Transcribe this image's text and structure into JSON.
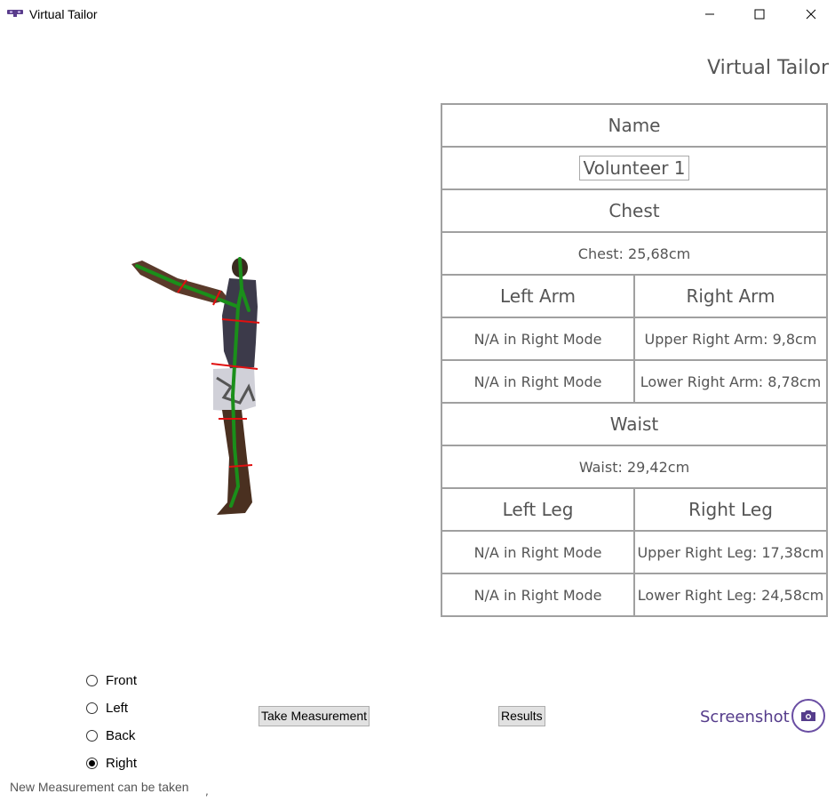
{
  "window": {
    "title": "Virtual Tailor",
    "app_icon": "kinect-icon",
    "controls": [
      "minimize-icon",
      "maximize-icon",
      "close-icon"
    ]
  },
  "header": {
    "title": "Virtual Tailor"
  },
  "table": {
    "name_header": "Name",
    "name_value": "Volunteer 1",
    "chest_header": "Chest",
    "chest_value": "Chest: 25,68cm",
    "left_arm_header": "Left Arm",
    "right_arm_header": "Right Arm",
    "left_arm_upper": "N/A in Right Mode",
    "right_arm_upper": "Upper Right Arm: 9,8cm",
    "left_arm_lower": "N/A in Right Mode",
    "right_arm_lower": "Lower Right Arm: 8,78cm",
    "waist_header": "Waist",
    "waist_value": "Waist: 29,42cm",
    "left_leg_header": "Left Leg",
    "right_leg_header": "Right Leg",
    "left_leg_upper": "N/A in Right Mode",
    "right_leg_upper": "Upper Right Leg: 17,38cm",
    "left_leg_lower": "N/A in Right Mode",
    "right_leg_lower": "Lower Right Leg: 24,58cm"
  },
  "modes": {
    "front": "Front",
    "left": "Left",
    "back": "Back",
    "right": "Right",
    "selected": "Right"
  },
  "buttons": {
    "take_measurement": "Take Measurement",
    "results": "Results"
  },
  "screenshot": {
    "label": "Screenshot",
    "icon": "camera-icon"
  },
  "status": {
    "message": "New Measurement can be taken",
    "trailing": ","
  },
  "colors": {
    "skeleton": "#1a8f1a",
    "measure_marks": "#e01010",
    "accent": "#553c8b"
  }
}
